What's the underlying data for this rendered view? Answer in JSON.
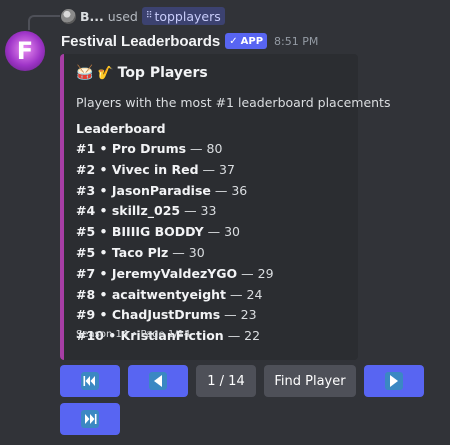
{
  "reply": {
    "user": "B...",
    "used_text": "used",
    "command": "topplayers"
  },
  "message": {
    "avatar_letter": "F",
    "username": "Festival Leaderboards",
    "app_tag": "APP",
    "timestamp": "8:51 PM"
  },
  "embed": {
    "accent_color": "#a73ea5",
    "title": "Top Players",
    "title_icons": [
      "drum-icon",
      "saxophone-icon"
    ],
    "description": "Players with the most #1 leaderboard placements",
    "field_name": "Leaderboard",
    "rows": [
      {
        "entry": "#1 • Pro Drums",
        "count": " — 80"
      },
      {
        "entry": "#2 • Vivec in Red",
        "count": " — 37"
      },
      {
        "entry": "#3 • JasonParadise",
        "count": " — 36"
      },
      {
        "entry": "#4 • skillz_025",
        "count": " — 33"
      },
      {
        "entry": "#5 • BIIIIG BODDY",
        "count": " — 30"
      },
      {
        "entry": "#5 • Taco Plz",
        "count": " — 30"
      },
      {
        "entry": "#7 • JeremyValdezYGO",
        "count": " — 29"
      },
      {
        "entry": "#8 • acaitwentyeight",
        "count": " — 24"
      },
      {
        "entry": "#9 • ChadJustDrums",
        "count": " — 23"
      },
      {
        "entry": "#10 • KristianFiction",
        "count": " — 22"
      }
    ],
    "footer": "Season 14 • Page 1/14"
  },
  "buttons": {
    "first_icon": "first-page-icon",
    "prev_icon": "previous-page-icon",
    "page_label": "1 / 14",
    "find_label": "Find Player",
    "next_icon": "next-page-icon",
    "last_icon": "last-page-icon"
  },
  "colors": {
    "background": "#313338",
    "primary_button": "#5865f2",
    "secondary_button": "#4e5058",
    "embed_background": "#2b2d31"
  }
}
